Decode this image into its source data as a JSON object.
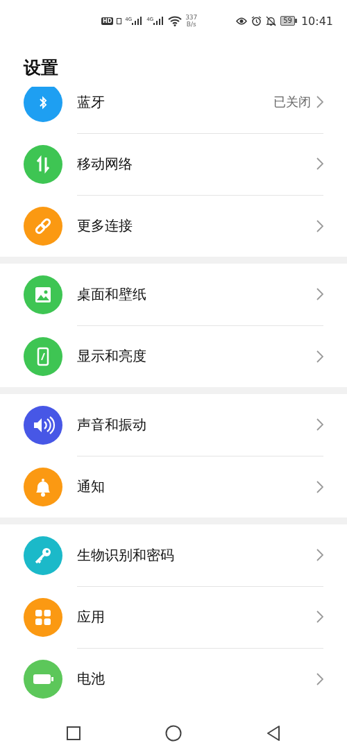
{
  "status_bar": {
    "hd": "HD",
    "signals": [
      "4G",
      "4G"
    ],
    "speed_value": "337",
    "speed_unit": "B/s",
    "battery": "59",
    "time": "10:41"
  },
  "title": "设置",
  "groups": [
    {
      "items": [
        {
          "label": "蓝牙",
          "value": "已关闭",
          "kind": "bluetooth",
          "color": "#1e9ff2"
        },
        {
          "label": "移动网络",
          "kind": "updown",
          "color": "#3ec553"
        },
        {
          "label": "更多连接",
          "kind": "link",
          "color": "#fb9912"
        }
      ]
    },
    {
      "items": [
        {
          "label": "桌面和壁纸",
          "kind": "image",
          "color": "#3ec553"
        },
        {
          "label": "显示和亮度",
          "kind": "phone",
          "color": "#3ec553"
        }
      ]
    },
    {
      "items": [
        {
          "label": "声音和振动",
          "kind": "speaker",
          "color": "#4757e6"
        },
        {
          "label": "通知",
          "kind": "bell",
          "color": "#fb9912"
        }
      ]
    },
    {
      "items": [
        {
          "label": "生物识别和密码",
          "kind": "key",
          "color": "#1bb9c9"
        },
        {
          "label": "应用",
          "kind": "grid",
          "color": "#fb9912"
        },
        {
          "label": "电池",
          "kind": "battery",
          "color": "#5cc75a"
        }
      ]
    }
  ]
}
